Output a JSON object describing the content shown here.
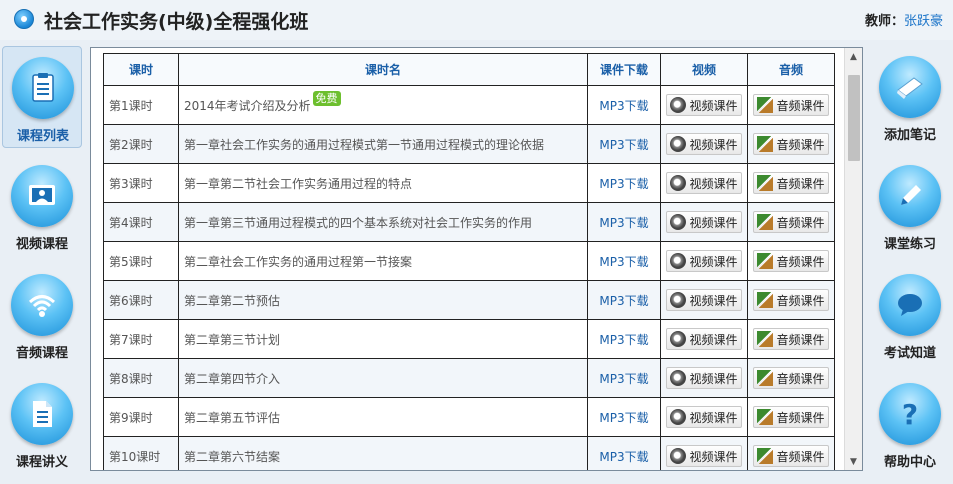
{
  "header": {
    "title": "社会工作实务(中级)全程强化班",
    "teacher_label": "教师：",
    "teacher_name": "张跃豪"
  },
  "left_nav": [
    {
      "label": "课程列表",
      "icon": "list-icon",
      "active": true
    },
    {
      "label": "视频课程",
      "icon": "video-icon",
      "active": false
    },
    {
      "label": "音频课程",
      "icon": "audio-icon",
      "active": false
    },
    {
      "label": "课程讲义",
      "icon": "document-icon",
      "active": false
    }
  ],
  "right_nav": [
    {
      "label": "添加笔记",
      "icon": "note-icon"
    },
    {
      "label": "课堂练习",
      "icon": "pencil-icon"
    },
    {
      "label": "考试知道",
      "icon": "chat-icon"
    },
    {
      "label": "帮助中心",
      "icon": "help-icon"
    }
  ],
  "table": {
    "columns": [
      "课时",
      "课时名",
      "课件下载",
      "视频",
      "音频"
    ],
    "free_badge": "免费",
    "mp3_label": "MP3下载",
    "video_btn": "视频课件",
    "audio_btn": "音频课件",
    "rows": [
      {
        "no": "第1课时",
        "name": "2014年考试介绍及分析",
        "free": true
      },
      {
        "no": "第2课时",
        "name": "第一章社会工作实务的通用过程模式第一节通用过程模式的理论依据",
        "free": false
      },
      {
        "no": "第3课时",
        "name": "第一章第二节社会工作实务通用过程的特点",
        "free": false
      },
      {
        "no": "第4课时",
        "name": "第一章第三节通用过程模式的四个基本系统对社会工作实务的作用",
        "free": false
      },
      {
        "no": "第5课时",
        "name": "第二章社会工作实务的通用过程第一节接案",
        "free": false
      },
      {
        "no": "第6课时",
        "name": "第二章第二节预估",
        "free": false
      },
      {
        "no": "第7课时",
        "name": "第二章第三节计划",
        "free": false
      },
      {
        "no": "第8课时",
        "name": "第二章第四节介入",
        "free": false
      },
      {
        "no": "第9课时",
        "name": "第二章第五节评估",
        "free": false
      },
      {
        "no": "第10课时",
        "name": "第二章第六节结案",
        "free": false
      }
    ]
  },
  "colors": {
    "accent": "#1a5fa8",
    "link": "#1a73c8",
    "free_badge": "#6dbf2e"
  }
}
